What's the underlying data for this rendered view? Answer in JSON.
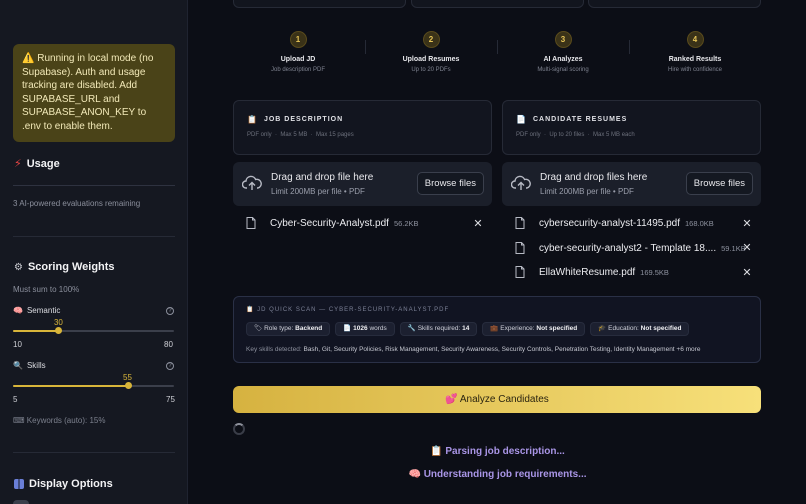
{
  "sidebar": {
    "warning": "⚠️ Running in local mode (no Supabase). Auth and usage tracking are disabled. Add SUPABASE_URL and SUPABASE_ANON_KEY to .env to enable them.",
    "usage": {
      "title": "Usage",
      "remaining": "3 AI-powered evaluations remaining"
    },
    "scoring": {
      "title": "Scoring Weights",
      "subtitle": "Must sum to 100%",
      "semantic": {
        "label": "Semantic",
        "value": "30",
        "min": "10",
        "max": "80",
        "fraction": 0.2857
      },
      "skills": {
        "label": "Skills",
        "value": "55",
        "min": "5",
        "max": "75",
        "fraction": 0.7143
      },
      "keywords": "Keywords (auto): 15%"
    },
    "display": {
      "title": "Display Options"
    }
  },
  "steps": [
    {
      "num": "1",
      "title": "Upload JD",
      "sub": "Job description PDF"
    },
    {
      "num": "2",
      "title": "Upload Resumes",
      "sub": "Up to 20 PDFs"
    },
    {
      "num": "3",
      "title": "AI Analyzes",
      "sub": "Multi-signal scoring"
    },
    {
      "num": "4",
      "title": "Ranked Results",
      "sub": "Hire with confidence"
    }
  ],
  "jd": {
    "title": "JOB DESCRIPTION",
    "meta": "PDF only  ·  Max 5 MB  ·  Max 15 pages",
    "drop_title": "Drag and drop file here",
    "drop_sub": "Limit 200MB per file • PDF",
    "browse": "Browse files",
    "files": [
      {
        "name": "Cyber-Security-Analyst.pdf",
        "size": "56.2KB"
      }
    ]
  },
  "resumes": {
    "title": "CANDIDATE RESUMES",
    "meta": "PDF only  ·  Up to 20 files  ·  Max 5 MB each",
    "drop_title": "Drag and drop files here",
    "drop_sub": "Limit 200MB per file • PDF",
    "browse": "Browse files",
    "files": [
      {
        "name": "cybersecurity-analyst-11495.pdf",
        "size": "168.0KB"
      },
      {
        "name": "cyber-security-analyst2 - Template 18....",
        "size": "59.1KB"
      },
      {
        "name": "EllaWhiteResume.pdf",
        "size": "169.5KB"
      }
    ]
  },
  "scan": {
    "title": "JD QUICK SCAN — CYBER-SECURITY-ANALYST.PDF",
    "role_label": "Role type: ",
    "role_value": "Backend",
    "words_value": "1026",
    "words_label": " words",
    "skills_label": "Skills required: ",
    "skills_value": "14",
    "exp_label": "Experience: ",
    "exp_value": "Not specified",
    "edu_label": "Education: ",
    "edu_value": "Not specified",
    "key_label": "Key skills detected: ",
    "key_value": "Bash, Git, Security Policies, Risk Management, Security Awareness, Security Controls, Penetration Testing, Identity Management +6 more"
  },
  "analyze_label": "💕 Analyze Candidates",
  "status": [
    "📋 Parsing job description...",
    "🧠 Understanding job requirements..."
  ],
  "colors": {
    "accent": "#d8b53a",
    "status_text": "#a995e6",
    "warning_bg": "#4a4318"
  }
}
